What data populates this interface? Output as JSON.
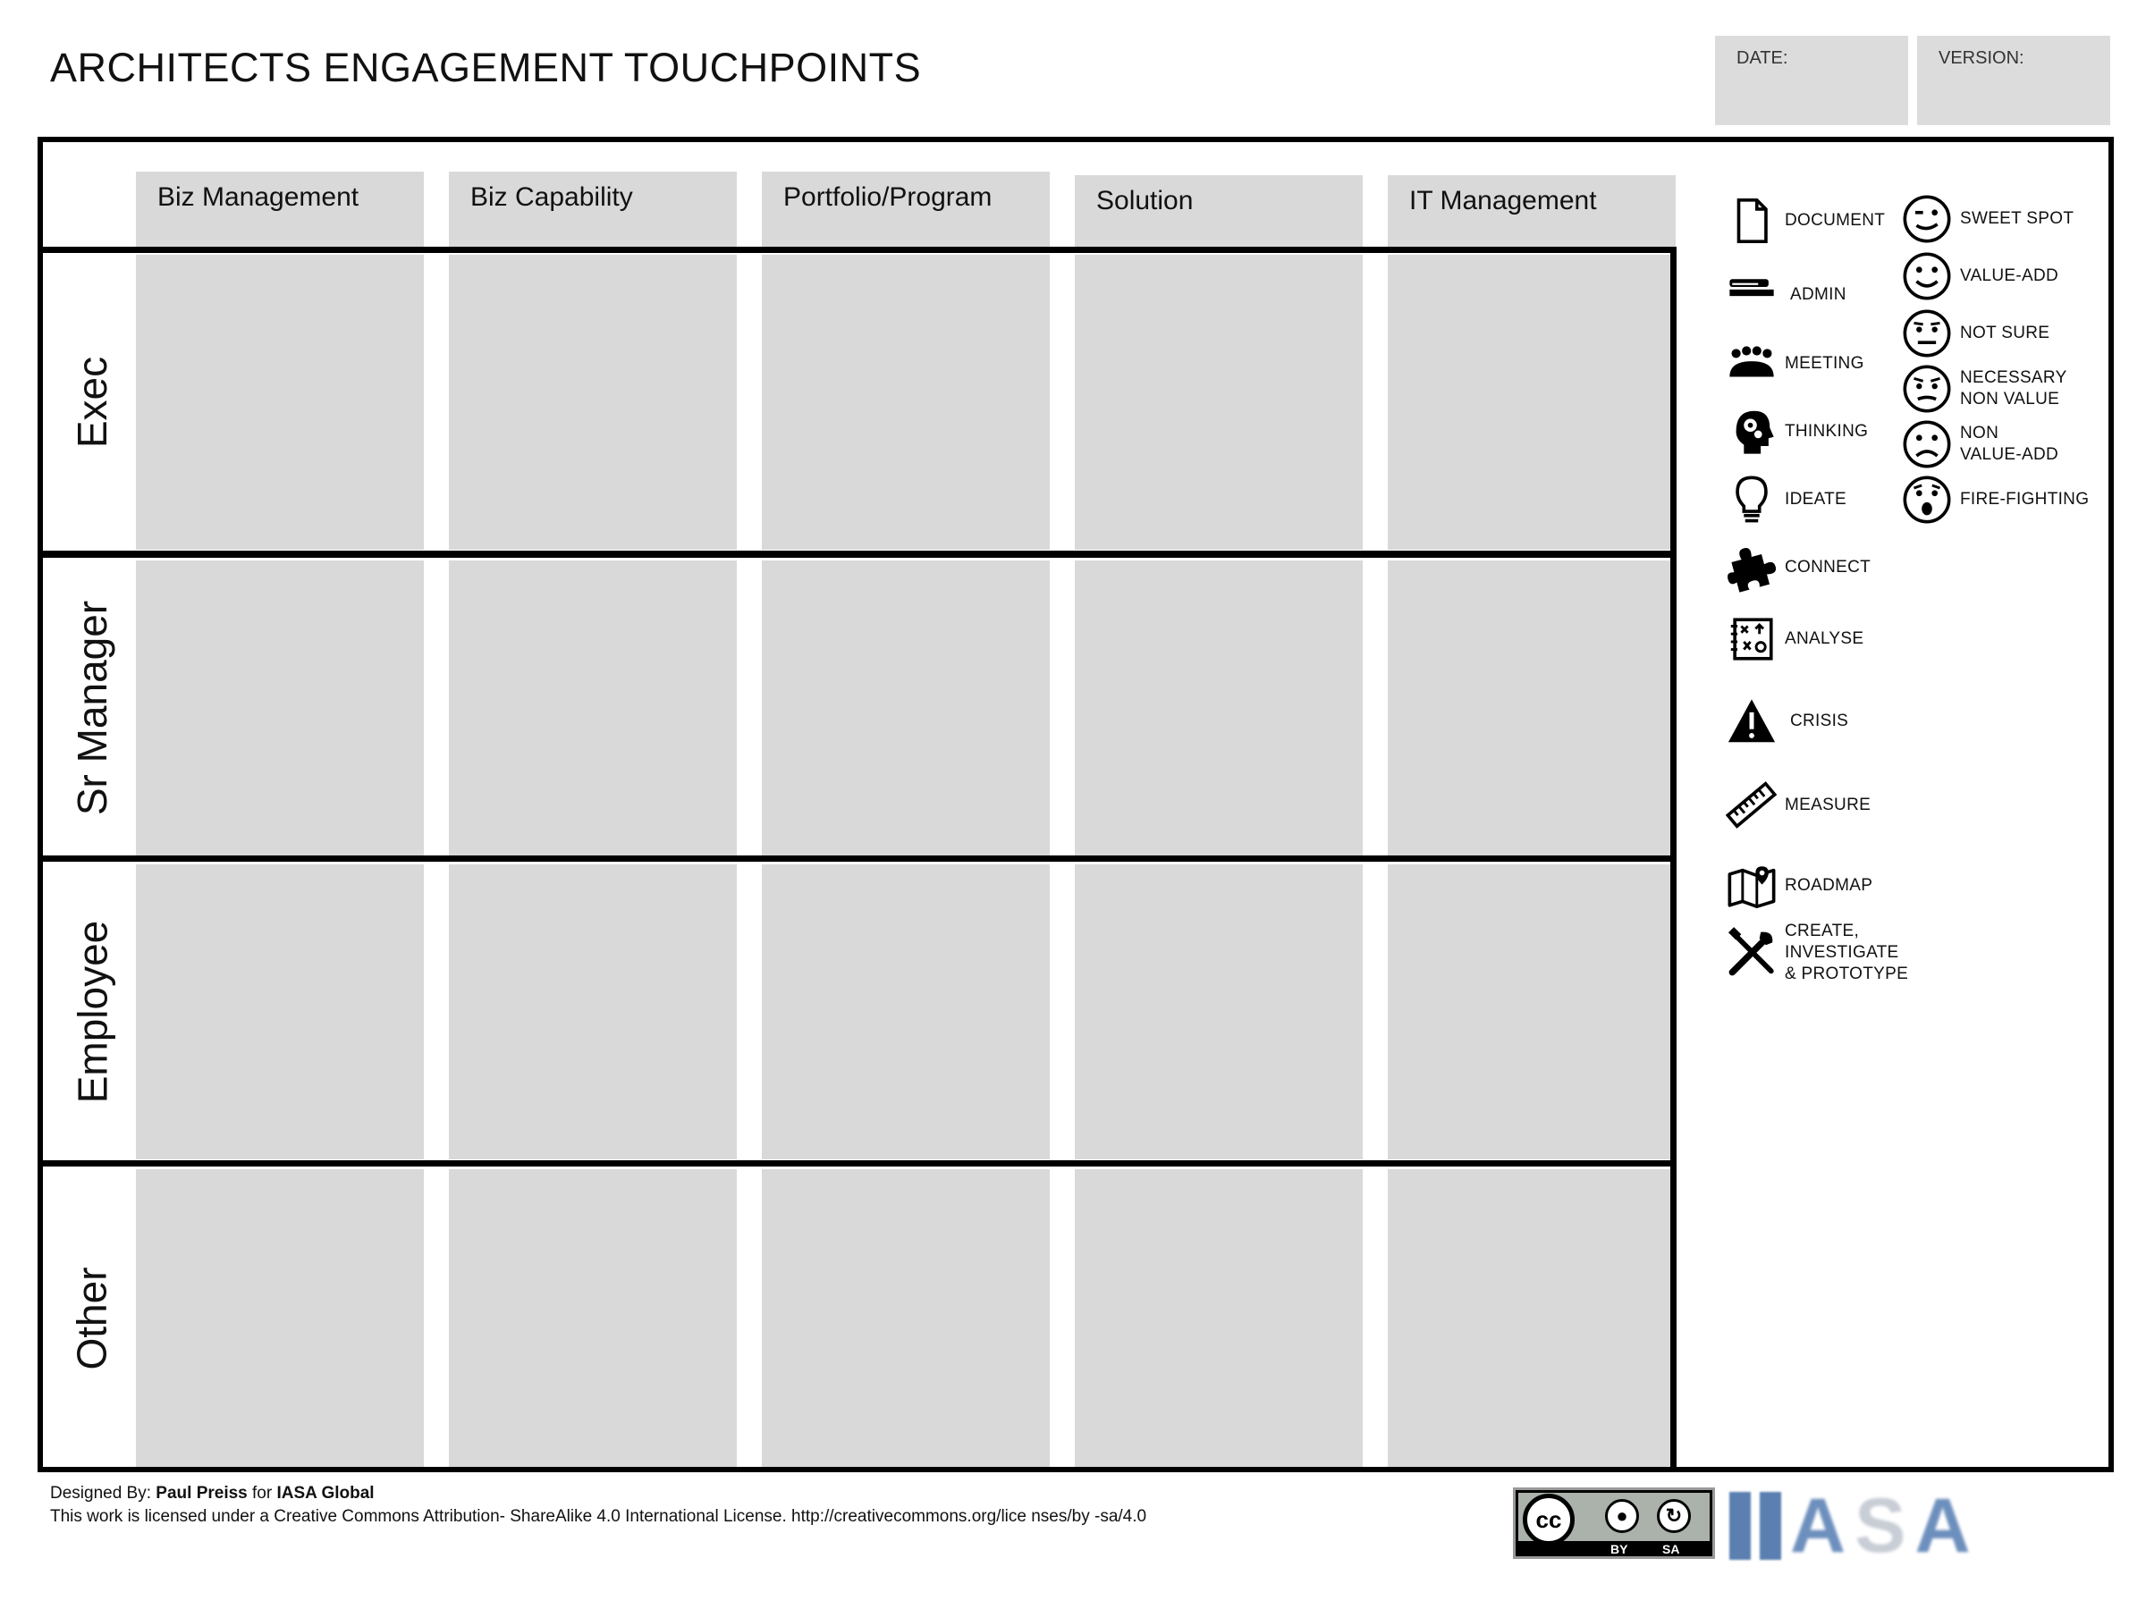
{
  "title": "ARCHITECTS ENGAGEMENT TOUCHPOINTS",
  "meta": {
    "date_label": "DATE:",
    "version_label": "VERSION:"
  },
  "columns": [
    "Biz Management",
    "Biz Capability",
    "Portfolio/Program",
    "Solution",
    "IT Management"
  ],
  "rows": [
    "Exec",
    "Sr Manager",
    "Employee",
    "Other"
  ],
  "legend_left": [
    {
      "label": "DOCUMENT",
      "icon": "document-icon"
    },
    {
      "label": "ADMIN",
      "icon": "stapler-icon"
    },
    {
      "label": "MEETING",
      "icon": "meeting-icon"
    },
    {
      "label": "THINKING",
      "icon": "thinking-head-icon"
    },
    {
      "label": "IDEATE",
      "icon": "lightbulb-icon"
    },
    {
      "label": "CONNECT",
      "icon": "puzzle-icon"
    },
    {
      "label": "ANALYSE",
      "icon": "analyse-board-icon"
    },
    {
      "label": "CRISIS",
      "icon": "warning-icon"
    },
    {
      "label": "MEASURE",
      "icon": "ruler-icon"
    },
    {
      "label": "ROADMAP",
      "icon": "map-icon"
    },
    {
      "label": "CREATE,\nINVESTIGATE\n& PROTOTYPE",
      "icon": "tools-icon"
    }
  ],
  "legend_right": [
    {
      "label": "SWEET SPOT",
      "icon": "wink-face-icon"
    },
    {
      "label": "VALUE-ADD",
      "icon": "smile-face-icon"
    },
    {
      "label": "NOT SURE",
      "icon": "neutral-face-icon"
    },
    {
      "label": "NECESSARY\nNON VALUE",
      "icon": "unsure-face-icon"
    },
    {
      "label": "NON\nVALUE-ADD",
      "icon": "sad-face-icon"
    },
    {
      "label": "FIRE-FIGHTING",
      "icon": "surprised-face-icon"
    }
  ],
  "footer": {
    "designed_by_prefix": "Designed By:",
    "designer": "Paul Preiss",
    "for_word": "for",
    "organization": "IASA Global",
    "license": "This work is licensed under a Creative Commons Attribution-  ShareAlike 4.0 International License. http://creativecommons.org/lice     nses/by -sa/4.0"
  },
  "cc_badge": {
    "cc": "cc",
    "by": "BY",
    "sa": "SA"
  },
  "logo": {
    "letters": [
      "A",
      "S",
      "A"
    ]
  }
}
